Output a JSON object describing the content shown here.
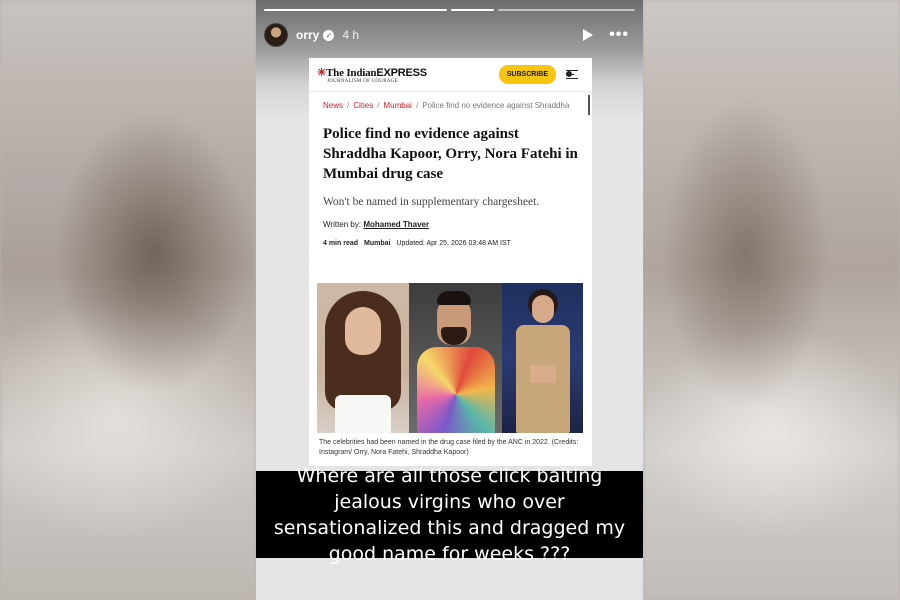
{
  "story": {
    "username": "orry",
    "time_ago": "4 h",
    "progress": {
      "segments": 3,
      "completed": 1,
      "current_fraction": 0.5
    },
    "icons": {
      "verified": "verified-badge-icon",
      "play": "play-icon",
      "more": "more-options-icon"
    }
  },
  "article": {
    "publication": {
      "the": "The ",
      "name": "Indian",
      "express": "EXPRESS",
      "tagline": "JOURNALISM OF COURAGE"
    },
    "subscribe_label": "SUBSCRIBE",
    "breadcrumb": [
      "News",
      "Cities",
      "Mumbai"
    ],
    "breadcrumb_current": "Police find no evidence against Shraddha",
    "headline": "Police find no evidence against Shraddha Kapoor, Orry, Nora Fatehi in Mumbai drug case",
    "dek": "Won't be named in supplementary chargesheet.",
    "byline_label": "Written by:",
    "author": "Mohamed Thaver",
    "read_time": "4 min read",
    "location": "Mumbai",
    "updated": "Updated: Apr 25, 2026 03:48 AM IST",
    "caption": "The celebrities had been named in the drug case filed by the ANC in 2022. (Credits: Instagram/ Orry, Nora Fatehi, Shraddha Kapoor)"
  },
  "overlay_text": "Where are all those click baiting jealous virgins who over sensationalized this and dragged my good name for weeks ???",
  "colors": {
    "brand_red": "#c8202b",
    "subscribe_yellow": "#f6c60f",
    "overlay_bg": "#000000"
  }
}
